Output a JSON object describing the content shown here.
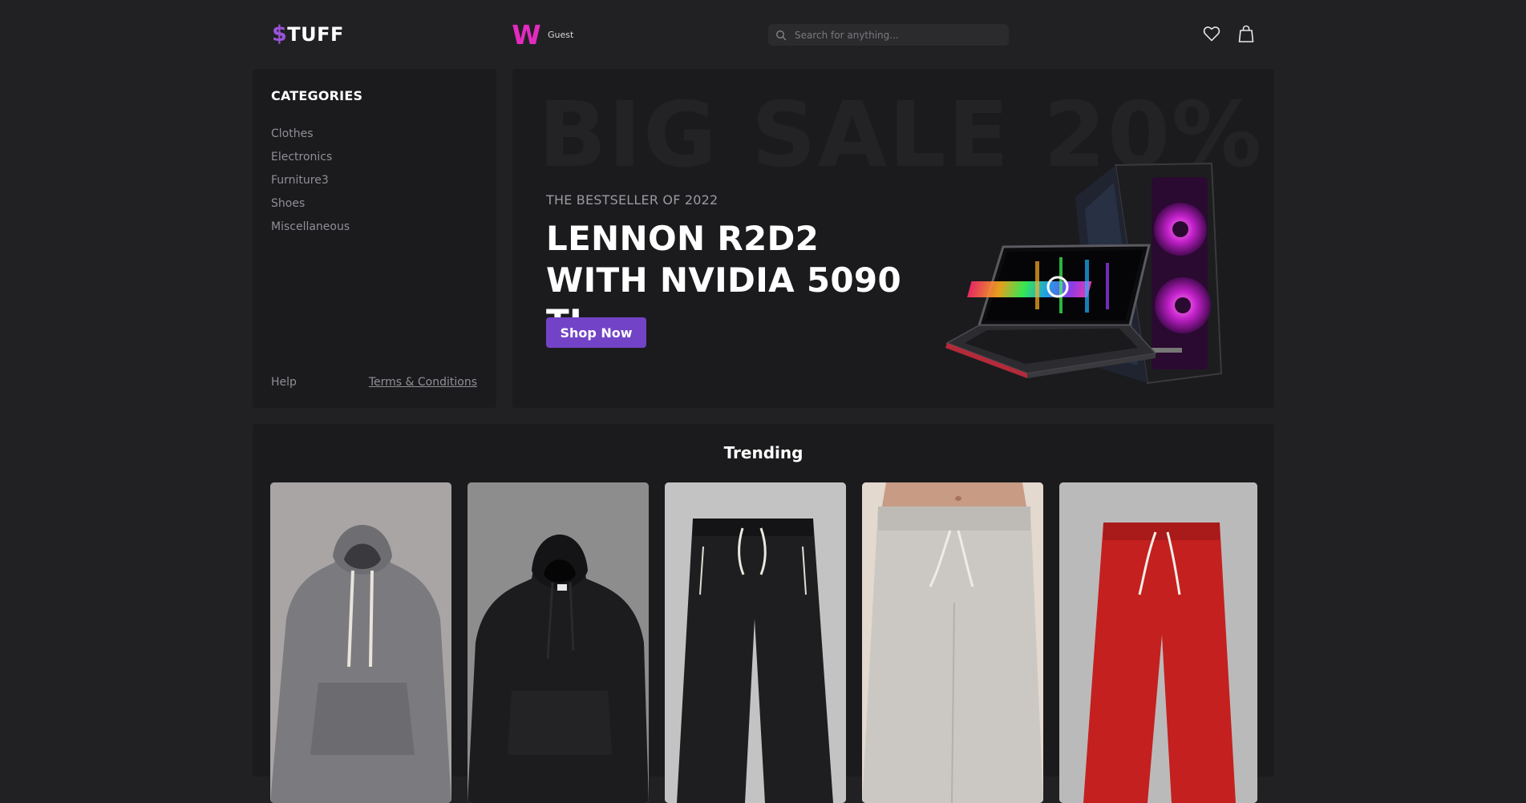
{
  "header": {
    "logo_symbol": "$",
    "logo_text": "TUFF",
    "user_initial": "W",
    "user_name": "Guest",
    "search_placeholder": "Search for anything...",
    "icons": [
      "search-icon",
      "heart-icon",
      "shopping-bag-icon"
    ]
  },
  "sidebar": {
    "title": "CATEGORIES",
    "items": [
      {
        "label": "Clothes"
      },
      {
        "label": "Electronics"
      },
      {
        "label": "Furniture3"
      },
      {
        "label": "Shoes"
      },
      {
        "label": "Miscellaneous"
      }
    ],
    "help": "Help",
    "terms": "Terms & Conditions"
  },
  "banner": {
    "bg_text": "BIG SALE 20%",
    "eyebrow": "THE BESTSELLER OF 2022",
    "headline": "LENNON R2D2 WITH NVIDIA 5090 TI",
    "cta": "Shop Now",
    "product": "gaming laptop and pc tower"
  },
  "trending": {
    "title": "Trending",
    "products": [
      {
        "item": "grey hoodie",
        "color": "#7d7c80"
      },
      {
        "item": "black hoodie",
        "color": "#1c1b1d"
      },
      {
        "item": "black sweatpants",
        "color": "#1e1e20"
      },
      {
        "item": "light grey sweatpants",
        "color": "#c9c6c2"
      },
      {
        "item": "red sweatpants",
        "color": "#c4201f"
      }
    ]
  },
  "colors": {
    "background": "#212124",
    "panel": "#1b1b1d",
    "accent": "#7243c6",
    "logo_accent": "#9b53d9",
    "avatar": "#e32bbf"
  }
}
